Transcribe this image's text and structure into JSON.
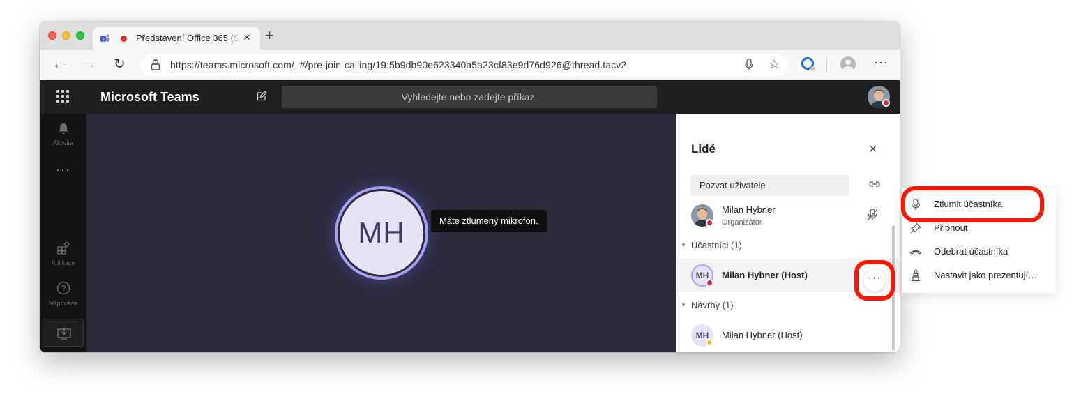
{
  "browser": {
    "tab_title": "Představení Office 365 (S",
    "tab_close": "×",
    "new_tab": "+",
    "url": "https://teams.microsoft.com/_#/pre-join-calling/19:5b9db90e623340a5a23cf83e9d76d926@thread.tacv2",
    "back": "←",
    "forward": "→",
    "reload": "↻",
    "star": "☆",
    "more": "···"
  },
  "teams": {
    "app_title": "Microsoft Teams",
    "search_placeholder": "Vyhledejte nebo zadejte příkaz.",
    "rail": {
      "activity": "Aktivita",
      "more": "···",
      "apps": "Aplikace",
      "help": "Nápověda"
    }
  },
  "stage": {
    "avatar_initials": "MH",
    "mute_tooltip": "Máte ztlumený mikrofon."
  },
  "people_panel": {
    "title": "Lidé",
    "close": "×",
    "invite_placeholder": "Pozvat uživatele",
    "organizer": {
      "name": "Milan Hybner",
      "role": "Organizátor"
    },
    "participants_header": "Účastníci (1)",
    "participant": {
      "initials": "MH",
      "name": "Milan Hybner (Host)"
    },
    "suggestions_header": "Návrhy (1)",
    "suggestion": {
      "initials": "MH",
      "name": "Milan Hybner (Host)"
    },
    "more_button": "···"
  },
  "context_menu": {
    "items": [
      {
        "label": "Ztlumit účastníka",
        "icon": "microphone-icon"
      },
      {
        "label": "Připnout",
        "icon": "pin-icon"
      },
      {
        "label": "Odebrat účastníka",
        "icon": "hang-up-icon"
      },
      {
        "label": "Nastavit jako prezentují…",
        "icon": "presenter-icon"
      }
    ]
  },
  "colors": {
    "highlight": "#ff1500",
    "status_busy": "#c4314b",
    "status_away": "#f8c21a",
    "stage_bg": "#2b2a3b",
    "avatar_ring": "#a8a0f0"
  }
}
